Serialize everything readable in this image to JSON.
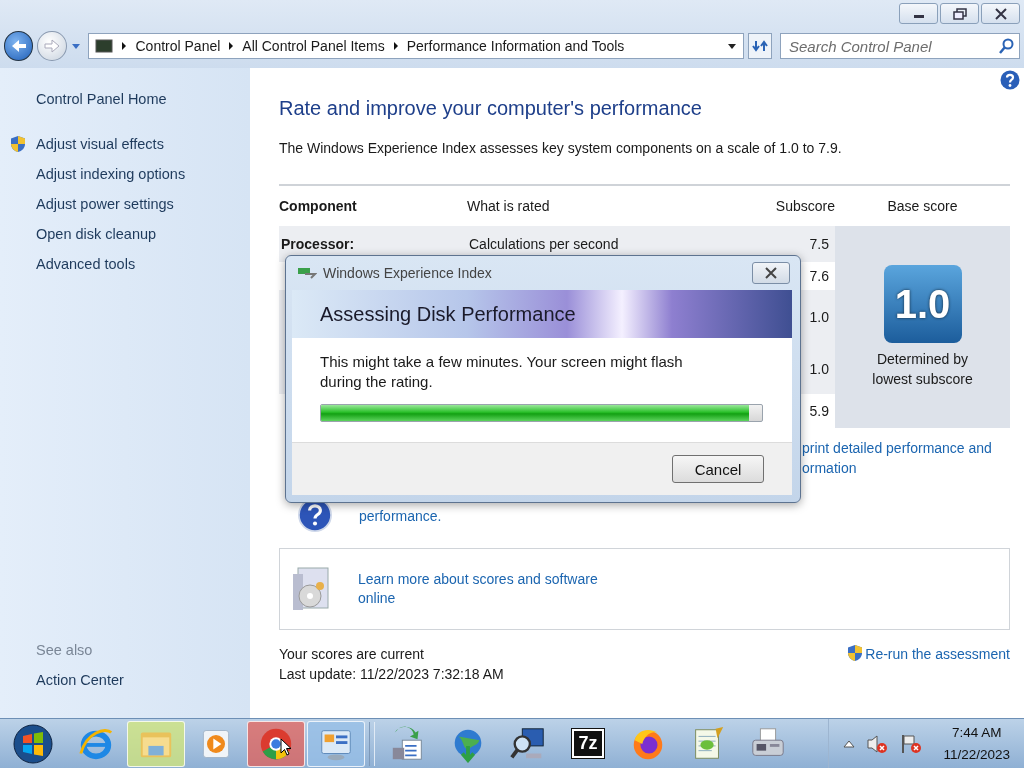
{
  "address_bar": {
    "breadcrumbs": [
      "Control Panel",
      "All Control Panel Items",
      "Performance Information and Tools"
    ]
  },
  "search": {
    "placeholder": "Search Control Panel"
  },
  "sidebar": {
    "items": [
      {
        "label": "Control Panel Home",
        "shield": false
      },
      {
        "label": "Adjust visual effects",
        "shield": true
      },
      {
        "label": "Adjust indexing options",
        "shield": false
      },
      {
        "label": "Adjust power settings",
        "shield": false
      },
      {
        "label": "Open disk cleanup",
        "shield": false
      },
      {
        "label": "Advanced tools",
        "shield": false
      }
    ],
    "see_also_heading": "See also",
    "see_also": [
      "Action Center"
    ]
  },
  "main": {
    "title": "Rate and improve your computer's performance",
    "description": "The Windows Experience Index assesses key system components on a scale of 1.0 to 7.9.",
    "table": {
      "columns": [
        "Component",
        "What is rated",
        "Subscore",
        "Base score"
      ],
      "rows": [
        {
          "component": "Processor:",
          "rated": "Calculations per second",
          "subscore": "7.5"
        },
        {
          "subscore": "7.6"
        },
        {
          "subscore": "1.0"
        },
        {
          "subscore": "1.0"
        },
        {
          "subscore": "5.9"
        }
      ]
    },
    "base_score": {
      "value": "1.0",
      "caption": "Determined by lowest subscore"
    },
    "print_link": [
      "print detailed performance and",
      "ormation"
    ],
    "tips_link": "performance.",
    "learn_link": "Learn more about scores and software online",
    "status": "Your scores are current",
    "last_update": "Last update: 11/22/2023 7:32:18 AM",
    "rerun": "Re-run the assessment"
  },
  "dialog": {
    "title": "Windows Experience Index",
    "heading": "Assessing Disk Performance",
    "message": "This might take a few minutes. Your screen might flash during the rating.",
    "progress": {
      "level": 0.97
    },
    "buttons": [
      "Cancel"
    ]
  },
  "taskbar": {
    "items": [
      {
        "kind": "ie",
        "running": false
      },
      {
        "kind": "explorer",
        "running": true
      },
      {
        "kind": "media",
        "running": false
      },
      {
        "kind": "chrome",
        "running": true
      },
      {
        "kind": "controlpanel",
        "running": true
      },
      {
        "kind": "installer",
        "running": false
      },
      {
        "kind": "globe",
        "running": false
      },
      {
        "kind": "magnifier",
        "running": false
      },
      {
        "kind": "sevenzip",
        "label": "7z",
        "running": false
      },
      {
        "kind": "firefox",
        "running": false
      },
      {
        "kind": "notepad",
        "running": false
      },
      {
        "kind": "fax",
        "running": false
      }
    ],
    "clock": {
      "time": "7:44 AM",
      "date": "11/22/2023"
    }
  }
}
